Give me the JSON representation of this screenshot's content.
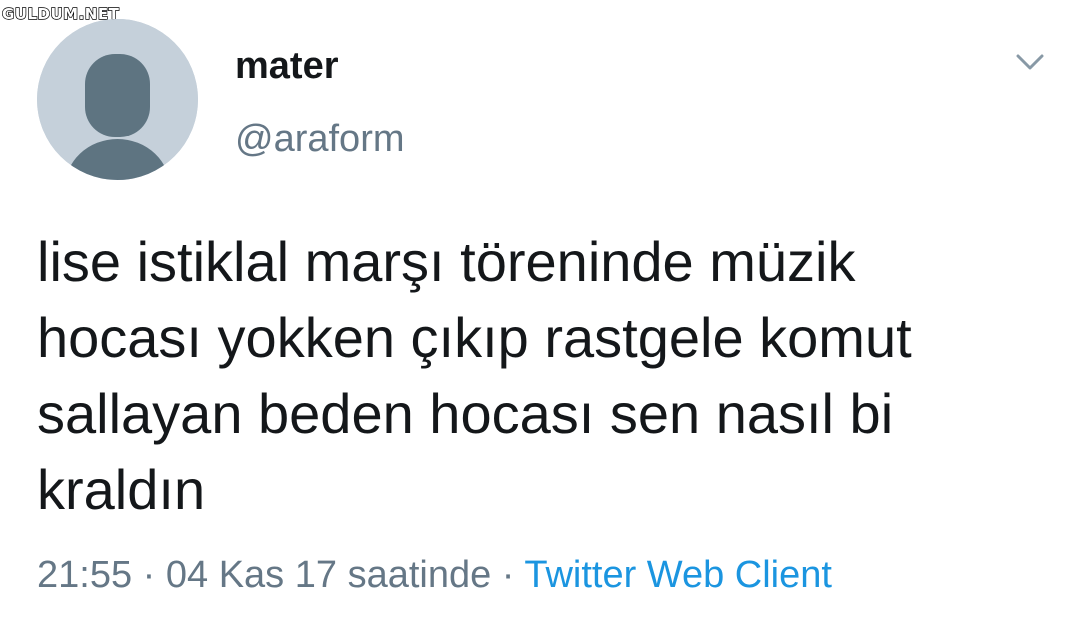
{
  "watermark": "GULDUM.NET",
  "tweet": {
    "author": {
      "display_name": "mater",
      "handle": "@araform",
      "avatar_icon": "default-profile-avatar-icon"
    },
    "menu_icon": "chevron-down-icon",
    "text_lines": [
      "lise istiklal marşı töreninde müzik",
      "hocası yokken çıkıp rastgele komut",
      "sallayan beden hocası sen nasıl bi",
      "kraldın"
    ],
    "time": "21:55",
    "date_text": "04 Kas 17 saatinde",
    "separator": "·",
    "source": "Twitter Web Client"
  },
  "colors": {
    "text": "#14171a",
    "secondary": "#657786",
    "link": "#1b95e0",
    "avatar_bg": "#c5d0da",
    "avatar_figure": "#5e7481"
  }
}
